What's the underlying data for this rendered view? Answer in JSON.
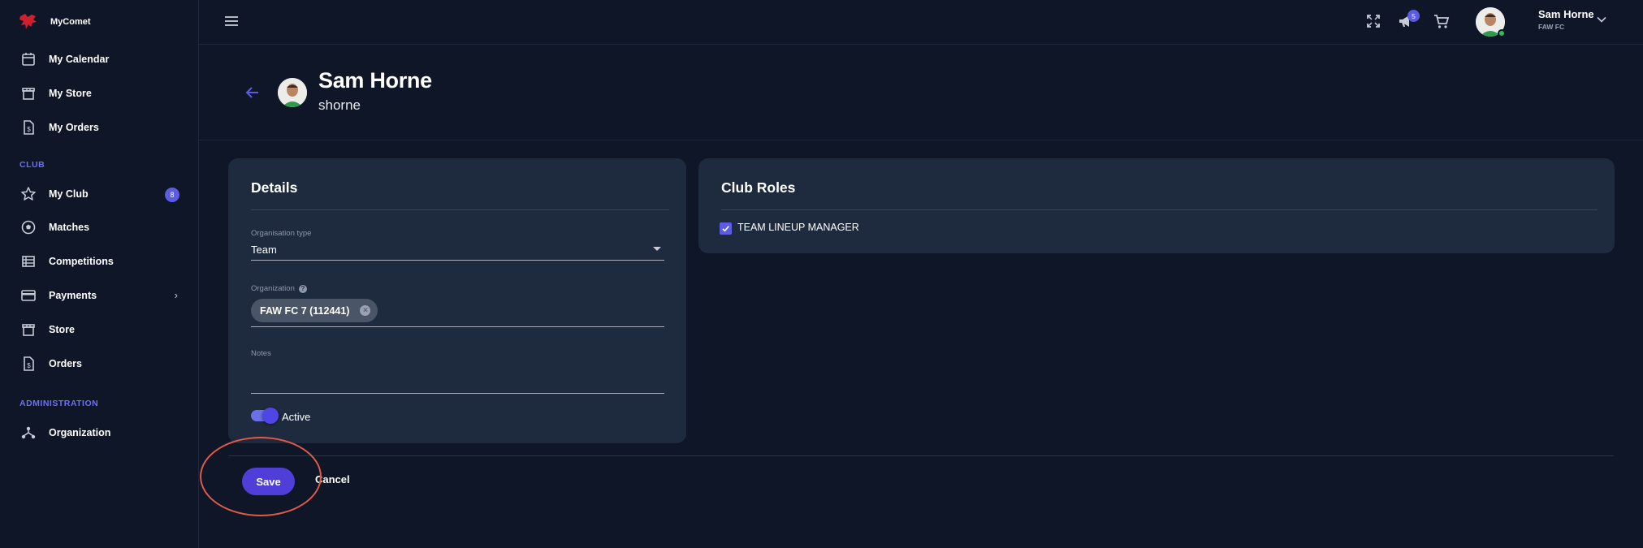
{
  "app": {
    "name": "MyComet"
  },
  "sidebar": {
    "items": [
      {
        "label": "My Calendar",
        "icon": "calendar-icon"
      },
      {
        "label": "My Store",
        "icon": "store-icon"
      },
      {
        "label": "My Orders",
        "icon": "receipt-icon"
      }
    ],
    "club_section": "CLUB",
    "club_items": [
      {
        "label": "My Club",
        "icon": "star-icon",
        "badge": "8"
      },
      {
        "label": "Matches",
        "icon": "soccer-ball-icon"
      },
      {
        "label": "Competitions",
        "icon": "list-icon"
      },
      {
        "label": "Payments",
        "icon": "credit-card-icon",
        "chevron": "›"
      },
      {
        "label": "Store",
        "icon": "store-icon"
      },
      {
        "label": "Orders",
        "icon": "receipt-icon"
      }
    ],
    "admin_section": "ADMINISTRATION",
    "admin_items": [
      {
        "label": "Organization",
        "icon": "hierarchy-icon"
      }
    ]
  },
  "topbar": {
    "notification_count": "5",
    "user_name": "Sam Horne",
    "user_org": "FAW FC"
  },
  "profile": {
    "name": "Sam Horne",
    "username": "shorne"
  },
  "details": {
    "title": "Details",
    "org_type_label": "Organisation type",
    "org_type_value": "Team",
    "organization_label": "Organization",
    "organization_chip": "FAW FC 7 (112441)",
    "notes_label": "Notes",
    "notes_value": "",
    "active_label": "Active",
    "active": true
  },
  "club_roles": {
    "title": "Club Roles",
    "roles": [
      {
        "label": "TEAM LINEUP MANAGER",
        "checked": true
      }
    ]
  },
  "actions": {
    "save_label": "Save",
    "cancel_label": "Cancel"
  },
  "colors": {
    "background": "#0e1628",
    "card": "#1e2a3e",
    "accent": "#5b5ce2",
    "save_button": "#4f3fd8",
    "highlight": "#e05a48"
  }
}
